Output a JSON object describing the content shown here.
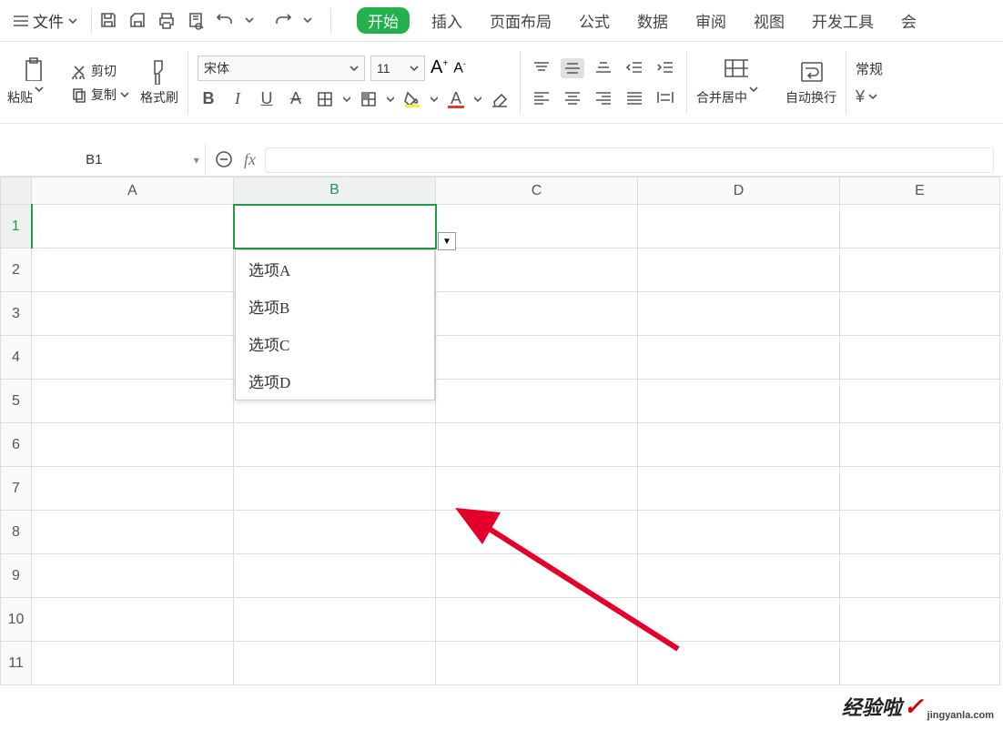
{
  "file_menu": {
    "label": "文件"
  },
  "tabs": {
    "start": "开始",
    "insert": "插入",
    "layout": "页面布局",
    "formula": "公式",
    "data": "数据",
    "review": "审阅",
    "view": "视图",
    "devtool": "开发工具",
    "member": "会"
  },
  "clipboard": {
    "paste": "粘贴",
    "cut": "剪切",
    "copy": "复制",
    "format_painter": "格式刷"
  },
  "font": {
    "name": "宋体",
    "size": "11",
    "increase": "A⁺",
    "decrease": "A⁻"
  },
  "merge": {
    "label": "合并居中"
  },
  "wrap": {
    "label": "自动换行"
  },
  "number": {
    "label": "常规"
  },
  "namebox": {
    "value": "B1"
  },
  "columns": [
    "A",
    "B",
    "C",
    "D",
    "E"
  ],
  "rows": [
    "1",
    "2",
    "3",
    "4",
    "5",
    "6",
    "7",
    "8",
    "9",
    "10",
    "11"
  ],
  "selected_col": "B",
  "selected_row": "1",
  "dropdown_options": [
    "选项A",
    "选项B",
    "选项C",
    "选项D"
  ],
  "watermark": {
    "text": "经验啦",
    "sub": "jingyanla.com"
  }
}
